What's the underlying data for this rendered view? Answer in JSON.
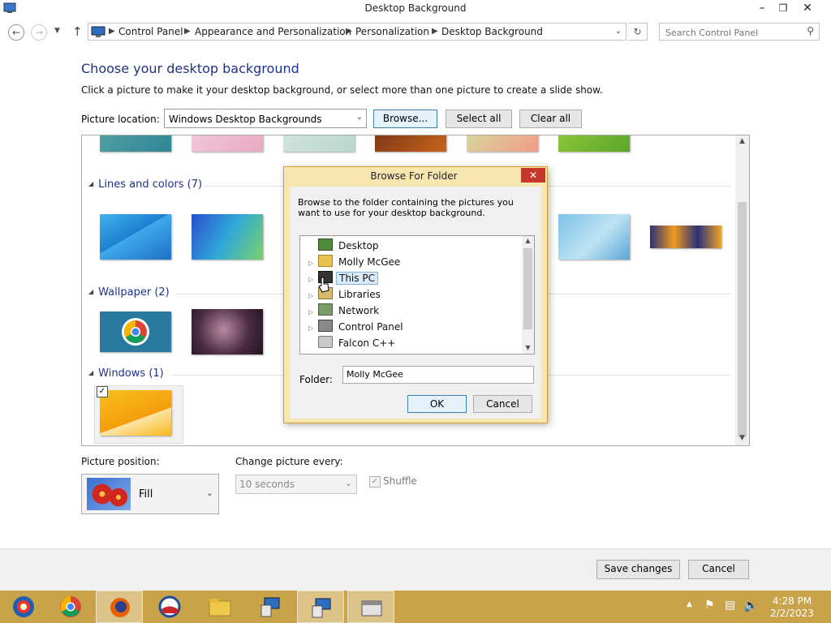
{
  "window": {
    "title": "Desktop Background"
  },
  "breadcrumb": [
    "Control Panel",
    "Appearance and Personalization",
    "Personalization",
    "Desktop Background"
  ],
  "search": {
    "placeholder": "Search Control Panel"
  },
  "main": {
    "heading": "Choose your desktop background",
    "subheading": "Click a picture to make it your desktop background, or select more than one picture to create a slide show.",
    "location_label": "Picture location:",
    "location_value": "Windows Desktop Backgrounds",
    "browse_label": "Browse...",
    "select_all_label": "Select all",
    "clear_all_label": "Clear all"
  },
  "groups": [
    {
      "title": "Lines and colors (7)"
    },
    {
      "title": "Wallpaper (2)"
    },
    {
      "title": "Windows (1)"
    }
  ],
  "bottom": {
    "position_label": "Picture position:",
    "position_value": "Fill",
    "change_label": "Change picture every:",
    "change_value": "10 seconds",
    "shuffle_label": "Shuffle"
  },
  "footer": {
    "save_label": "Save changes",
    "cancel_label": "Cancel"
  },
  "dialog": {
    "title": "Browse For Folder",
    "description": "Browse to the folder containing the pictures you want to use for your desktop background.",
    "tree": [
      "Desktop",
      "Molly McGee",
      "This PC",
      "Libraries",
      "Network",
      "Control Panel",
      "Falcon C++"
    ],
    "folder_label": "Folder:",
    "folder_value": "Molly McGee",
    "ok_label": "OK",
    "cancel_label": "Cancel"
  },
  "taskbar": {
    "time": "4:28 PM",
    "date": "2/2/2023"
  },
  "colors": {
    "accent": "#1e3287",
    "taskbar": "#c9a34a",
    "dialog_frame": "#f8e6b1"
  }
}
